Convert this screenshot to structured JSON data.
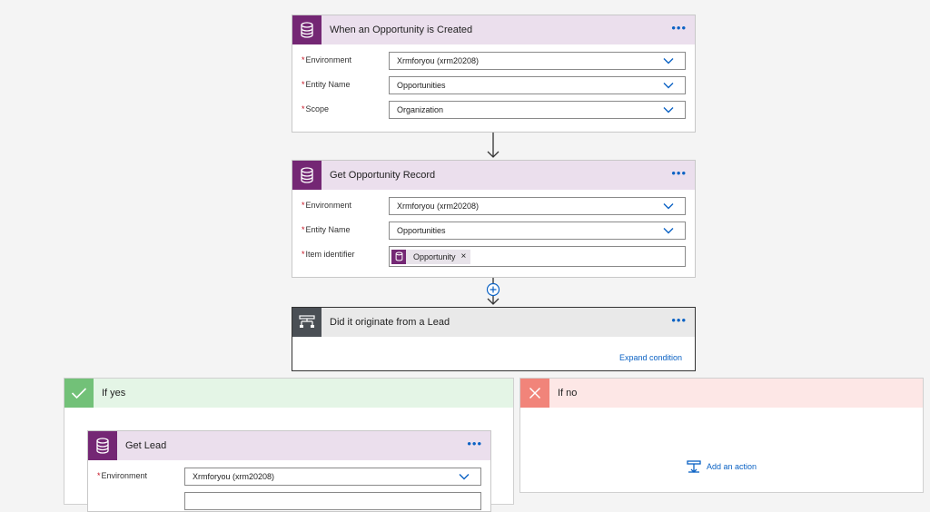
{
  "colors": {
    "accent": "#742774",
    "header_purple_light": "#ebdfed",
    "condition_header": "#e9e9e9",
    "condition_icon": "#4a4f55",
    "yes_header": "#e4f5e6",
    "yes_icon": "#72c178",
    "no_header": "#fde7e6",
    "no_icon": "#f1847a",
    "link": "#0b62c4",
    "required": "#c50f1f"
  },
  "trigger": {
    "title": "When an Opportunity is Created",
    "menu_icon": "ellipsis-icon",
    "icon": "database-icon",
    "fields": [
      {
        "label": "Environment",
        "value": "Xrmforyou (xrm20208)"
      },
      {
        "label": "Entity Name",
        "value": "Opportunities"
      },
      {
        "label": "Scope",
        "value": "Organization"
      }
    ]
  },
  "get_record": {
    "title": "Get Opportunity Record",
    "icon": "database-icon",
    "fields": [
      {
        "label": "Environment",
        "value": "Xrmforyou (xrm20208)"
      },
      {
        "label": "Entity Name",
        "value": "Opportunities"
      },
      {
        "label": "Item identifier",
        "token": "Opportunity"
      }
    ]
  },
  "condition": {
    "title": "Did it originate from a Lead",
    "icon": "condition-icon",
    "expand_label": "Expand condition"
  },
  "branch_yes": {
    "title": "If yes",
    "icon": "checkmark-icon",
    "action": {
      "title": "Get Lead",
      "icon": "database-icon",
      "fields": [
        {
          "label": "Environment",
          "value": "Xrmforyou (xrm20208)"
        }
      ]
    }
  },
  "branch_no": {
    "title": "If no",
    "icon": "close-icon",
    "add_action_label": "Add an action"
  },
  "required_marker": "*"
}
